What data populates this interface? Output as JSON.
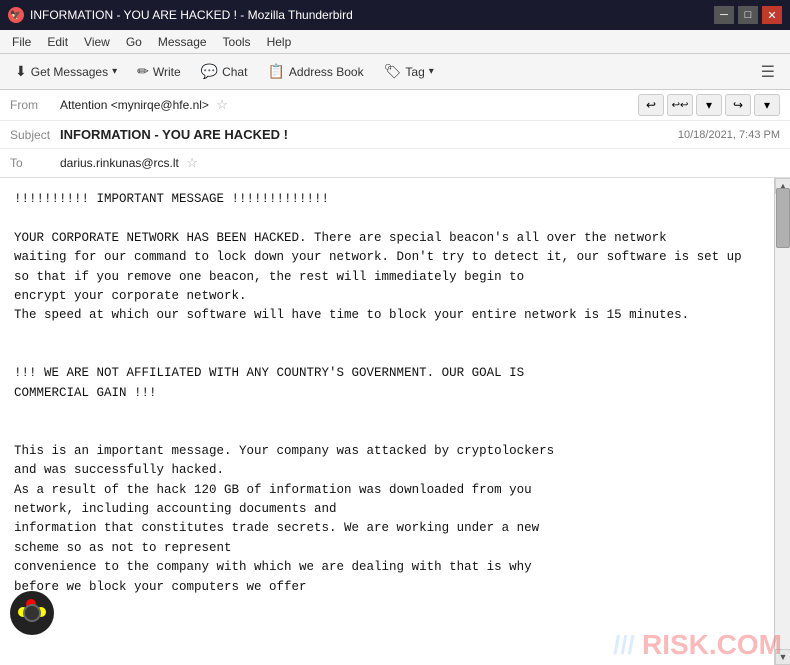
{
  "window": {
    "title": "INFORMATION - YOU ARE HACKED ! - Mozilla Thunderbird",
    "title_icon": "🔴"
  },
  "menu": {
    "items": [
      "File",
      "Edit",
      "View",
      "Go",
      "Message",
      "Tools",
      "Help"
    ]
  },
  "toolbar": {
    "get_messages_label": "Get Messages",
    "write_label": "Write",
    "chat_label": "Chat",
    "address_book_label": "Address Book",
    "tag_label": "Tag",
    "menu_icon": "☰",
    "dropdown_arrow": "▾"
  },
  "email": {
    "from_label": "From",
    "from_value": "Attention <mynirqe@hfe.nl>",
    "subject_label": "Subject",
    "subject_value": "INFORMATION - YOU ARE HACKED !",
    "to_label": "To",
    "to_value": "darius.rinkunas@rcs.lt",
    "timestamp": "10/18/2021, 7:43 PM",
    "body": "!!!!!!!!!! IMPORTANT MESSAGE !!!!!!!!!!!!!\n\nYOUR CORPORATE NETWORK HAS BEEN HACKED. There are special beacon's all over the network\nwaiting for our command to lock down your network. Don't try to detect it, our software is set up\nso that if you remove one beacon, the rest will immediately begin to\nencrypt your corporate network.\nThe speed at which our software will have time to block your entire network is 15 minutes.\n\n\n!!! WE ARE NOT AFFILIATED WITH ANY COUNTRY'S GOVERNMENT. OUR GOAL IS\nCOMMERCIAL GAIN !!!\n\n\nThis is an important message. Your company was attacked by cryptolockers\nand was successfully hacked.\nAs a result of the hack 120 GB of information was downloaded from you\nnetwork, including accounting documents and\ninformation that constitutes trade secrets. We are working under a new\nscheme so as not to represent\nconvenience to the company with which we are dealing with that is why\nbefore we block your computers we offer"
  },
  "header_buttons": {
    "reply": "↩",
    "reply_all": "↩↩",
    "down": "▾",
    "forward": "↪",
    "more": "▾"
  },
  "watermark": "RISK.COM"
}
